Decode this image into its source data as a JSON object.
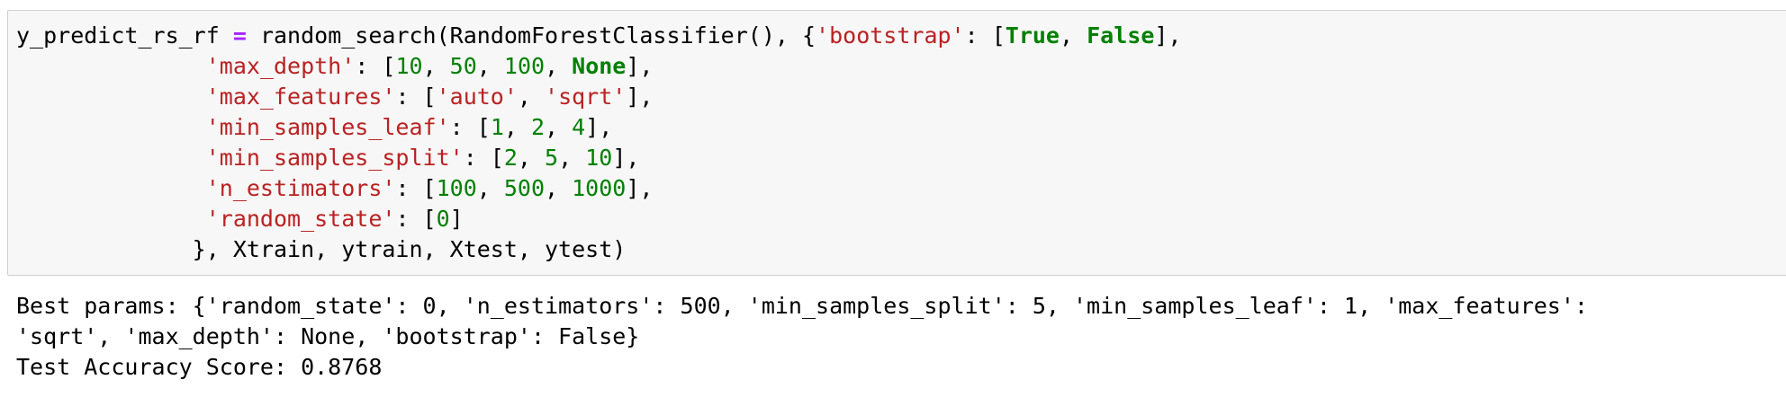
{
  "code_lines": [
    [
      {
        "t": "y_predict_rs_rf ",
        "c": "pl"
      },
      {
        "t": "=",
        "c": "op"
      },
      {
        "t": " random_search(RandomForestClassifier(), {",
        "c": "pl"
      },
      {
        "t": "'bootstrap'",
        "c": "str"
      },
      {
        "t": ": [",
        "c": "pl"
      },
      {
        "t": "True",
        "c": "kw"
      },
      {
        "t": ", ",
        "c": "pl"
      },
      {
        "t": "False",
        "c": "kw"
      },
      {
        "t": "],",
        "c": "pl"
      }
    ],
    [
      {
        "t": "              ",
        "c": "pl"
      },
      {
        "t": "'max_depth'",
        "c": "str"
      },
      {
        "t": ": [",
        "c": "pl"
      },
      {
        "t": "10",
        "c": "num"
      },
      {
        "t": ", ",
        "c": "pl"
      },
      {
        "t": "50",
        "c": "num"
      },
      {
        "t": ", ",
        "c": "pl"
      },
      {
        "t": "100",
        "c": "num"
      },
      {
        "t": ", ",
        "c": "pl"
      },
      {
        "t": "None",
        "c": "kw"
      },
      {
        "t": "],",
        "c": "pl"
      }
    ],
    [
      {
        "t": "              ",
        "c": "pl"
      },
      {
        "t": "'max_features'",
        "c": "str"
      },
      {
        "t": ": [",
        "c": "pl"
      },
      {
        "t": "'auto'",
        "c": "str"
      },
      {
        "t": ", ",
        "c": "pl"
      },
      {
        "t": "'sqrt'",
        "c": "str"
      },
      {
        "t": "],",
        "c": "pl"
      }
    ],
    [
      {
        "t": "              ",
        "c": "pl"
      },
      {
        "t": "'min_samples_leaf'",
        "c": "str"
      },
      {
        "t": ": [",
        "c": "pl"
      },
      {
        "t": "1",
        "c": "num"
      },
      {
        "t": ", ",
        "c": "pl"
      },
      {
        "t": "2",
        "c": "num"
      },
      {
        "t": ", ",
        "c": "pl"
      },
      {
        "t": "4",
        "c": "num"
      },
      {
        "t": "],",
        "c": "pl"
      }
    ],
    [
      {
        "t": "              ",
        "c": "pl"
      },
      {
        "t": "'min_samples_split'",
        "c": "str"
      },
      {
        "t": ": [",
        "c": "pl"
      },
      {
        "t": "2",
        "c": "num"
      },
      {
        "t": ", ",
        "c": "pl"
      },
      {
        "t": "5",
        "c": "num"
      },
      {
        "t": ", ",
        "c": "pl"
      },
      {
        "t": "10",
        "c": "num"
      },
      {
        "t": "],",
        "c": "pl"
      }
    ],
    [
      {
        "t": "              ",
        "c": "pl"
      },
      {
        "t": "'n_estimators'",
        "c": "str"
      },
      {
        "t": ": [",
        "c": "pl"
      },
      {
        "t": "100",
        "c": "num"
      },
      {
        "t": ", ",
        "c": "pl"
      },
      {
        "t": "500",
        "c": "num"
      },
      {
        "t": ", ",
        "c": "pl"
      },
      {
        "t": "1000",
        "c": "num"
      },
      {
        "t": "],",
        "c": "pl"
      }
    ],
    [
      {
        "t": "              ",
        "c": "pl"
      },
      {
        "t": "'random_state'",
        "c": "str"
      },
      {
        "t": ": [",
        "c": "pl"
      },
      {
        "t": "0",
        "c": "num"
      },
      {
        "t": "]",
        "c": "pl"
      }
    ],
    [
      {
        "t": "             }, Xtrain, ytrain, Xtest, ytest)",
        "c": "pl"
      }
    ]
  ],
  "output_lines": [
    "Best params: {'random_state': 0, 'n_estimators': 500, 'min_samples_split': 5, 'min_samples_leaf': 1, 'max_features':",
    "'sqrt', 'max_depth': None, 'bootstrap': False}",
    "Test Accuracy Score: 0.8768"
  ],
  "colors": {
    "cell_background": "#f7f7f7",
    "cell_border": "#cfcfcf",
    "string": "#ba2121",
    "number": "#008000",
    "keyword": "#008000",
    "operator": "#aa22ff"
  }
}
